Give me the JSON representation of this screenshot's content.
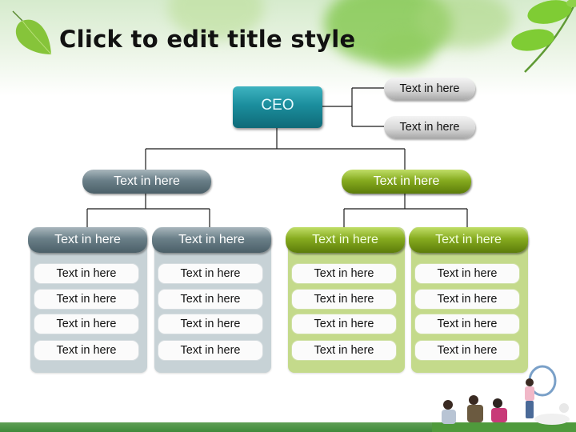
{
  "slide": {
    "title": "Click to edit title style"
  },
  "org_chart": {
    "root": {
      "label": "CEO"
    },
    "side_nodes": [
      {
        "label": "Text in here"
      },
      {
        "label": "Text in here"
      }
    ],
    "level2": [
      {
        "label": "Text in here",
        "style": "slate"
      },
      {
        "label": "Text in here",
        "style": "green"
      }
    ],
    "columns": [
      {
        "header": "Text in here",
        "style": "slate",
        "items": [
          "Text in here",
          "Text in here",
          "Text in here",
          "Text in here"
        ]
      },
      {
        "header": "Text in here",
        "style": "slate",
        "items": [
          "Text in here",
          "Text in here",
          "Text in here",
          "Text in here"
        ]
      },
      {
        "header": "Text in here",
        "style": "green",
        "items": [
          "Text in here",
          "Text in here",
          "Text in here",
          "Text in here"
        ]
      },
      {
        "header": "Text in here",
        "style": "green",
        "items": [
          "Text in here",
          "Text in here",
          "Text in here",
          "Text in here"
        ]
      }
    ]
  },
  "decorations": {
    "top_left_image": "leaf-icon",
    "top_right_image": "branch-leaves-icon",
    "bottom_right_image": "family-on-grass-photo"
  },
  "colors": {
    "ceo": "#1b8e9d",
    "slate": "#6a7f88",
    "green": "#86ab1f",
    "slate_panel": "#c7d2d6",
    "green_panel": "#c4da8b",
    "ground": "#3f8a3a"
  }
}
